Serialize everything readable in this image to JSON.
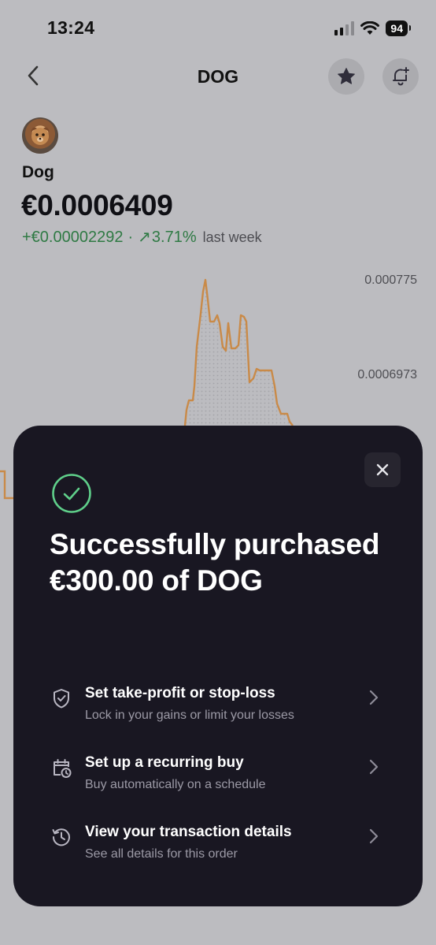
{
  "status_bar": {
    "time": "13:24",
    "battery": "94"
  },
  "nav": {
    "title": "DOG"
  },
  "asset": {
    "name": "Dog",
    "price": "€0.0006409",
    "change_amount": "+€0.00002292",
    "separator": "·",
    "change_arrow": "↗",
    "change_percent": "3.71%",
    "period": "last week"
  },
  "chart": {
    "line_color": "#d38a3e",
    "y_ticks": [
      "0.000775",
      "0.0006973"
    ]
  },
  "sheet": {
    "title": "Successfully purchased €300.00 of DOG",
    "close_icon": "close-icon",
    "success_icon": "check-circle-icon",
    "accent": "#5fcf8a",
    "actions": [
      {
        "title": "Set take-profit or stop-loss",
        "subtitle": "Lock in your gains or limit your losses",
        "icon": "shield-check-icon"
      },
      {
        "title": "Set up a recurring buy",
        "subtitle": "Buy automatically on a schedule",
        "icon": "calendar-clock-icon"
      },
      {
        "title": "View your transaction details",
        "subtitle": "See all details for this order",
        "icon": "history-icon"
      }
    ]
  }
}
